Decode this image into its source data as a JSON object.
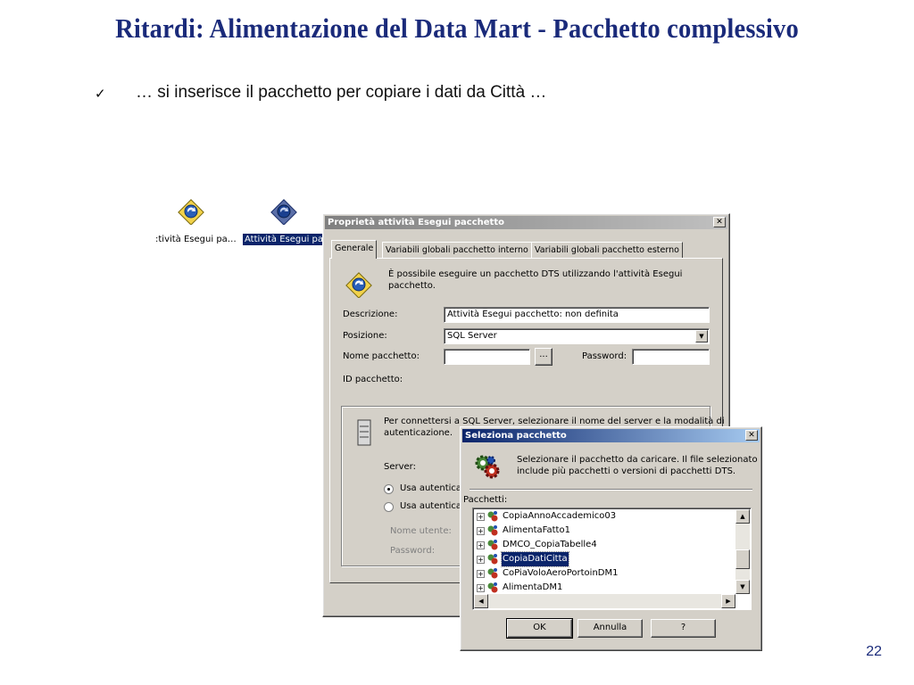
{
  "slide": {
    "title": "Ritardi: Alimentazione del Data Mart - Pacchetto complessivo",
    "bullet_mark": "✓",
    "bullet_text": "… si inserisce il pacchetto per copiare i dati da Città …",
    "page_number": "22",
    "title_color": "#1a2a7a"
  },
  "desktop_icons": [
    {
      "label": ":tività Esegui pa…",
      "selected": false
    },
    {
      "label": "Attività Esegui pa…",
      "selected": true
    }
  ],
  "properties_dialog": {
    "title": "Proprietà attività Esegui pacchetto",
    "close_glyph": "✕",
    "tabs": [
      {
        "label": "Generale"
      },
      {
        "label": "Variabili globali pacchetto interno"
      },
      {
        "label": "Variabili globali pacchetto esterno"
      }
    ],
    "intro_text_1": "È possibile eseguire un pacchetto DTS utilizzando l'attività Esegui",
    "intro_text_2": "pacchetto.",
    "description_label": "Descrizione:",
    "description_value": "Attività Esegui pacchetto: non definita",
    "position_label": "Posizione:",
    "position_value": "SQL Server",
    "package_name_label": "Nome pacchetto:",
    "package_name_value": "",
    "browse_label": "...",
    "password_label": "Password:",
    "password_value": "",
    "package_id_label": "ID pacchetto:",
    "connect_text_1": "Per connettersi a SQL Server, selezionare il nome del server e la modalità di",
    "connect_text_2": "autenticazione.",
    "server_label": "Server:",
    "radio_windows": "Usa autentica",
    "radio_sql": "Usa autentica",
    "username_label": "Nome utente:",
    "password2_label": "Password:"
  },
  "select_dialog": {
    "title": "Seleziona pacchetto",
    "close_glyph": "✕",
    "info_text_1": "Selezionare il pacchetto da caricare. Il file selezionato",
    "info_text_2": "include più pacchetti o versioni di pacchetti DTS.",
    "packages_label": "Pacchetti:",
    "packages": [
      {
        "name": "CopiaAnnoAccademico03",
        "selected": false
      },
      {
        "name": "AlimentaFatto1",
        "selected": false
      },
      {
        "name": "DMCO_CopiaTabelle4",
        "selected": false
      },
      {
        "name": "CopiaDatiCitta",
        "selected": true
      },
      {
        "name": "CoPiaVoloAeroPortoinDM1",
        "selected": false
      },
      {
        "name": "AlimentaDM1",
        "selected": false
      }
    ],
    "expander_glyph": "+",
    "ok_label": "OK",
    "cancel_label": "Annulla",
    "help_label": "?"
  }
}
